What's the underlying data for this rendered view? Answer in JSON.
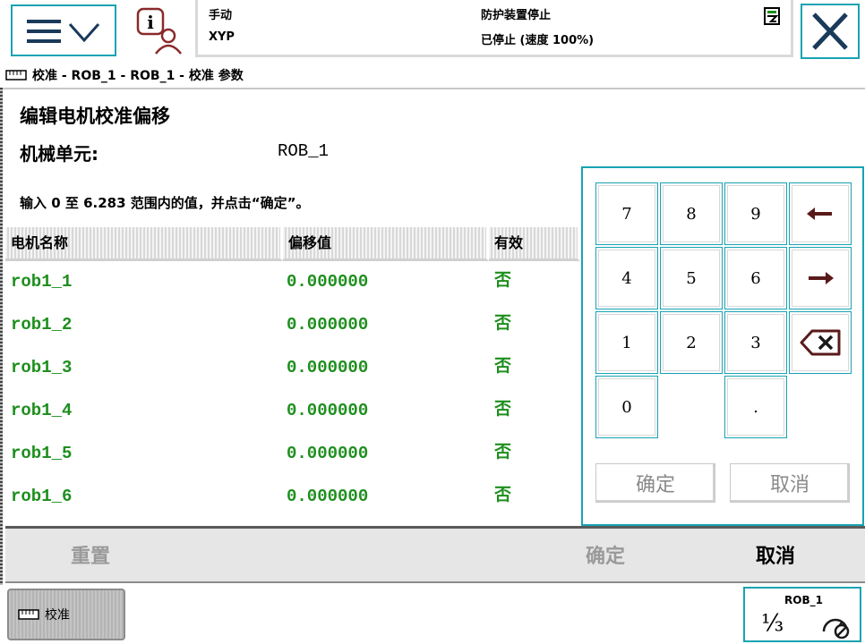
{
  "status": {
    "mode": "手动",
    "system": "XYP",
    "safety": "防护装置停止",
    "state": "已停止 (速度 100%)"
  },
  "breadcrumb": "校准 - ROB_1 - ROB_1 - 校准 参数",
  "page": {
    "title": "编辑电机校准偏移",
    "unit_label": "机械单元:",
    "unit_value": "ROB_1",
    "instruction": "输入 0 至 6.283 范围内的值，并点击“确定”。"
  },
  "table": {
    "headers": [
      "电机名称",
      "偏移值",
      "有效"
    ],
    "rows": [
      {
        "name": "rob1_1",
        "offset": "0.000000",
        "valid": "否"
      },
      {
        "name": "rob1_2",
        "offset": "0.000000",
        "valid": "否"
      },
      {
        "name": "rob1_3",
        "offset": "0.000000",
        "valid": "否"
      },
      {
        "name": "rob1_4",
        "offset": "0.000000",
        "valid": "否"
      },
      {
        "name": "rob1_5",
        "offset": "0.000000",
        "valid": "否"
      },
      {
        "name": "rob1_6",
        "offset": "0.000000",
        "valid": "否"
      }
    ]
  },
  "keypad": {
    "keys": [
      "7",
      "8",
      "9",
      "4",
      "5",
      "6",
      "1",
      "2",
      "3",
      "0",
      "."
    ],
    "ok_label": "确定",
    "cancel_label": "取消"
  },
  "actionbar": {
    "reset_label": "重置",
    "ok_label": "确定",
    "cancel_label": "取消"
  },
  "taskbar": {
    "calibration_label": "校准",
    "quickset_unit": "ROB_1",
    "quickset_fraction": "⅓"
  },
  "colors": {
    "accent": "#17a3b2",
    "value_green": "#1e8f1e",
    "disabled_text": "#9a9a9a"
  },
  "icons": [
    "menu-icon",
    "chevron-down-icon",
    "info-person-icon",
    "document-icon",
    "close-icon",
    "ruler-icon",
    "arrow-left-icon",
    "arrow-right-icon",
    "backspace-icon",
    "speed-icon"
  ]
}
